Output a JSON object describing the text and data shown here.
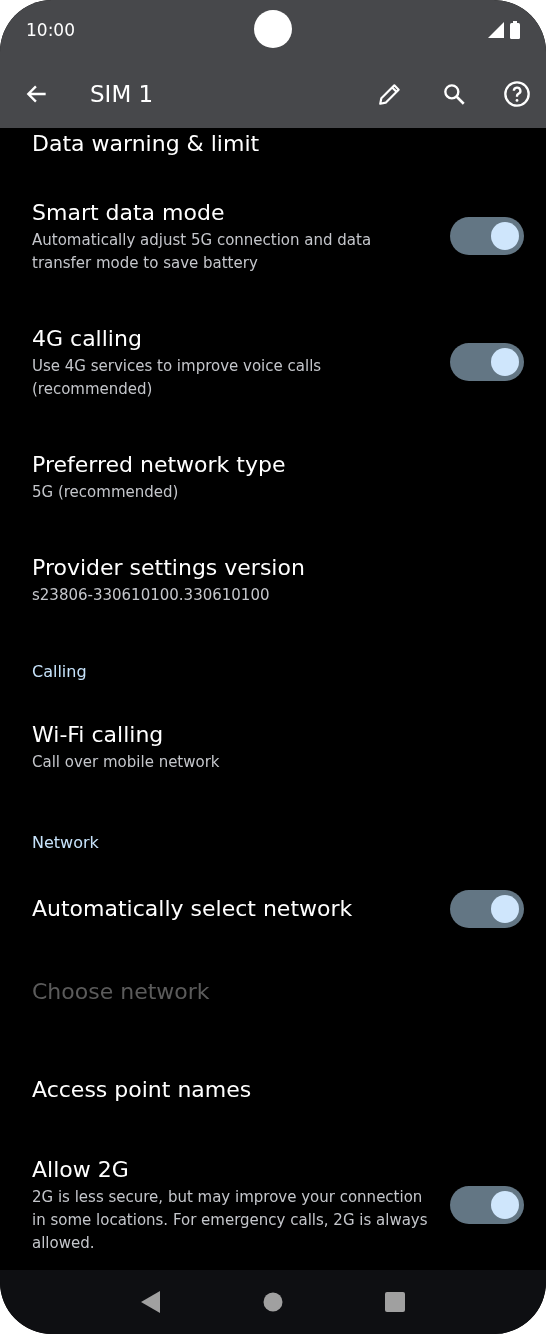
{
  "status_bar": {
    "time": "10:00"
  },
  "app_bar": {
    "title": "SIM 1"
  },
  "items": [
    {
      "kind": "setting",
      "title": "Data warning & limit"
    },
    {
      "kind": "switch",
      "title": "Smart data mode",
      "subtitle": "Automatically adjust 5G connection and data transfer mode to save battery",
      "on": true
    },
    {
      "kind": "switch",
      "title": "4G calling",
      "subtitle": "Use 4G services to improve voice calls (recommended)",
      "on": true
    },
    {
      "kind": "setting",
      "title": "Preferred network type",
      "subtitle": "5G (recommended)"
    },
    {
      "kind": "setting",
      "title": "Provider settings version",
      "subtitle": "s23806-330610100.330610100"
    },
    {
      "kind": "header",
      "title": "Calling"
    },
    {
      "kind": "setting",
      "title": "Wi-Fi calling",
      "subtitle": "Call over mobile network"
    },
    {
      "kind": "header",
      "title": "Network"
    },
    {
      "kind": "switch",
      "title": "Automatically select network",
      "on": true
    },
    {
      "kind": "setting",
      "title": "Choose network",
      "disabled": true
    },
    {
      "kind": "divider"
    },
    {
      "kind": "setting",
      "title": "Access point names"
    },
    {
      "kind": "switch",
      "title": "Allow 2G",
      "subtitle": "2G is less secure, but may improve your connection in some locations. For emergency calls, 2G is always allowed.",
      "on": true
    }
  ]
}
